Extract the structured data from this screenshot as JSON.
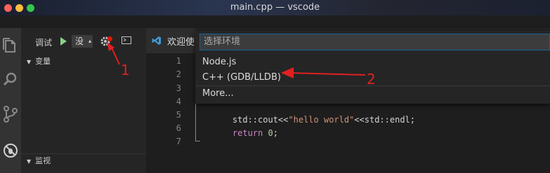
{
  "window": {
    "title": "main.cpp — vscode"
  },
  "debug_toolbar": {
    "debug_label": "调试",
    "config_select": "没"
  },
  "sidebar": {
    "variables_header": "变量",
    "watch_header": "监视"
  },
  "editor": {
    "tab_label": "欢迎使",
    "line_numbers": [
      "1",
      "2",
      "3",
      "4",
      "5",
      "6",
      "7"
    ],
    "line5_std": "std::cout<<",
    "line5_string": "\"hello world\"",
    "line5_tail": "<<std::endl;",
    "line6_return": "return",
    "line6_zero": "0",
    "line6_semicolon": ";"
  },
  "quick_pick": {
    "placeholder": "选择环境",
    "items": [
      "Node.js",
      "C++ (GDB/LLDB)",
      "More..."
    ]
  },
  "annotations": {
    "label1": "1",
    "label2": "2"
  }
}
